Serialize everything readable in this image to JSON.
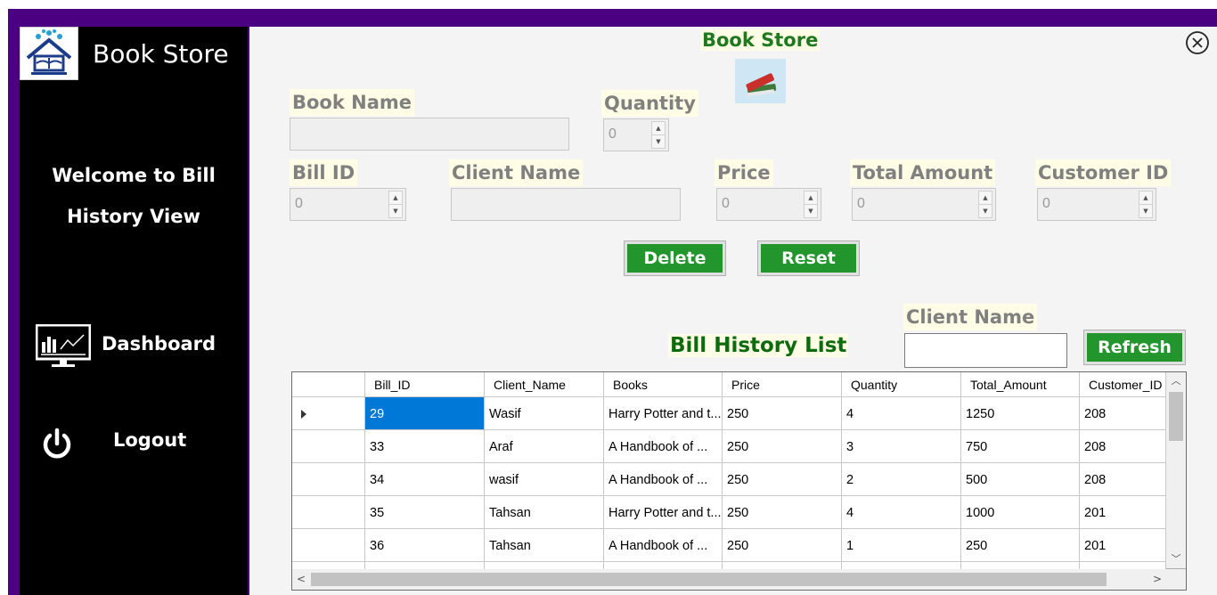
{
  "sidebar": {
    "brand": "Book Store",
    "welcome_line1": "Welcome to Bill",
    "welcome_line2": "History View",
    "items": [
      {
        "label": "Dashboard",
        "icon": "dashboard-monitor-icon"
      },
      {
        "label": "Logout",
        "icon": "power-icon"
      }
    ]
  },
  "header": {
    "title": "Book Store",
    "icon": "books-icon",
    "close_icon": "close-circle-icon"
  },
  "form": {
    "book_name_label": "Book Name",
    "book_name_value": "",
    "quantity_label": "Quantity",
    "quantity_value": "0",
    "bill_id_label": "Bill ID",
    "bill_id_value": "0",
    "client_name_label": "Client Name",
    "client_name_value": "",
    "price_label": "Price",
    "price_value": "0",
    "total_amount_label": "Total Amount",
    "total_amount_value": "0",
    "customer_id_label": "Customer ID",
    "customer_id_value": "0",
    "delete_label": "Delete",
    "reset_label": "Reset"
  },
  "list": {
    "title": "Bill History List",
    "filter_label": "Client Name",
    "filter_value": "",
    "refresh_label": "Refresh"
  },
  "table": {
    "columns": [
      "Bill_ID",
      "Client_Name",
      "Books",
      "Price",
      "Quantity",
      "Total_Amount",
      "Customer_ID"
    ],
    "rows": [
      [
        "29",
        "Wasif",
        "Harry Potter and t...",
        "250",
        "4",
        "1250",
        "208"
      ],
      [
        "33",
        "Araf",
        " A Handbook of ...",
        "250",
        "3",
        "750",
        "208"
      ],
      [
        "34",
        "wasif",
        " A Handbook of ...",
        "250",
        "2",
        "500",
        "208"
      ],
      [
        "35",
        "Tahsan",
        "Harry Potter and t...",
        "250",
        "4",
        "1000",
        "201"
      ],
      [
        "36",
        "Tahsan",
        " A Handbook of ...",
        "250",
        "1",
        "250",
        "201"
      ]
    ],
    "selected_row": 0,
    "selected_col": 0
  },
  "colors": {
    "frame": "#4b0082",
    "sidebar": "#000000",
    "button": "#22962d",
    "title_green": "#1f7a1f",
    "selection": "#0078d7"
  }
}
